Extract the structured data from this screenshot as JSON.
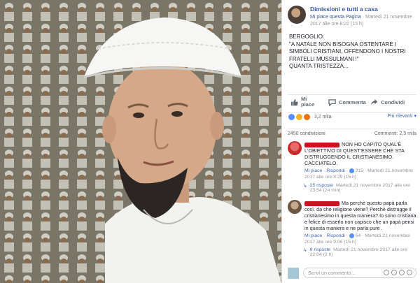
{
  "page": {
    "name": "Dimissioni e tutti a casa",
    "like_label": "Mi piace questa Pagina",
    "timestamp": "Martedì 21 novembre 2017 alle ore 8:22 (15 h)"
  },
  "post": {
    "text": "BERGOGLIO:\n\"A NATALE NON BISOGNA OSTENTARE I SIMBOLI CRISTIANI, OFFENDONO I NOSTRI FRATELLI MUSSULMANI !\"\nQUANTA TRISTEZZA..."
  },
  "actions": {
    "like_line1": "Mi",
    "like_line2": "piace",
    "comment": "Commenta",
    "share": "Condividi"
  },
  "reactions": {
    "count": "3,2 mila",
    "sort": "Più rilevanti ▾"
  },
  "stats": {
    "shares": "2450 condivisioni",
    "comments": "Commenti: 2,5 mila"
  },
  "comments": [
    {
      "text": "NON HO CAPITO QUAL'È L'OBIETTIVO DI QUEST'ESSERE CHE STA DISTRUGGENDO IL CRISTIANESIMO. CACCIATELO.",
      "like": "Mi piace",
      "reply": "Rispondi",
      "count": "215",
      "time": "Martedì 21 novembre 2017 alle ore 8:29 (15 h)",
      "replies_count": "25 risposte",
      "replies_time": "Martedì 21 novembre 2017 alle ore 23:54 (24 min)"
    },
    {
      "text": "Ma perchè questo papà parla così. da che religione viene? Perchè distrugge il cristianesimo in questa maniera? Io sono cristiana e felice di esserlo non capisco che un papà pensi in questa maniera e ne parla pure .",
      "like": "Mi piace",
      "reply": "Rispondi",
      "count": "64",
      "time": "Martedì 21 novembre 2017 alle ore 9:06 (15 h)",
      "replies_count": "8 risposte",
      "replies_time": "Martedì 21 novembre 2017 alle ore 22:04 (2 h)"
    }
  ],
  "write": {
    "placeholder": "Scrivi un commento..."
  },
  "colors": {
    "link": "#365899",
    "muted": "#90949c",
    "redaction": "#cc1122"
  }
}
